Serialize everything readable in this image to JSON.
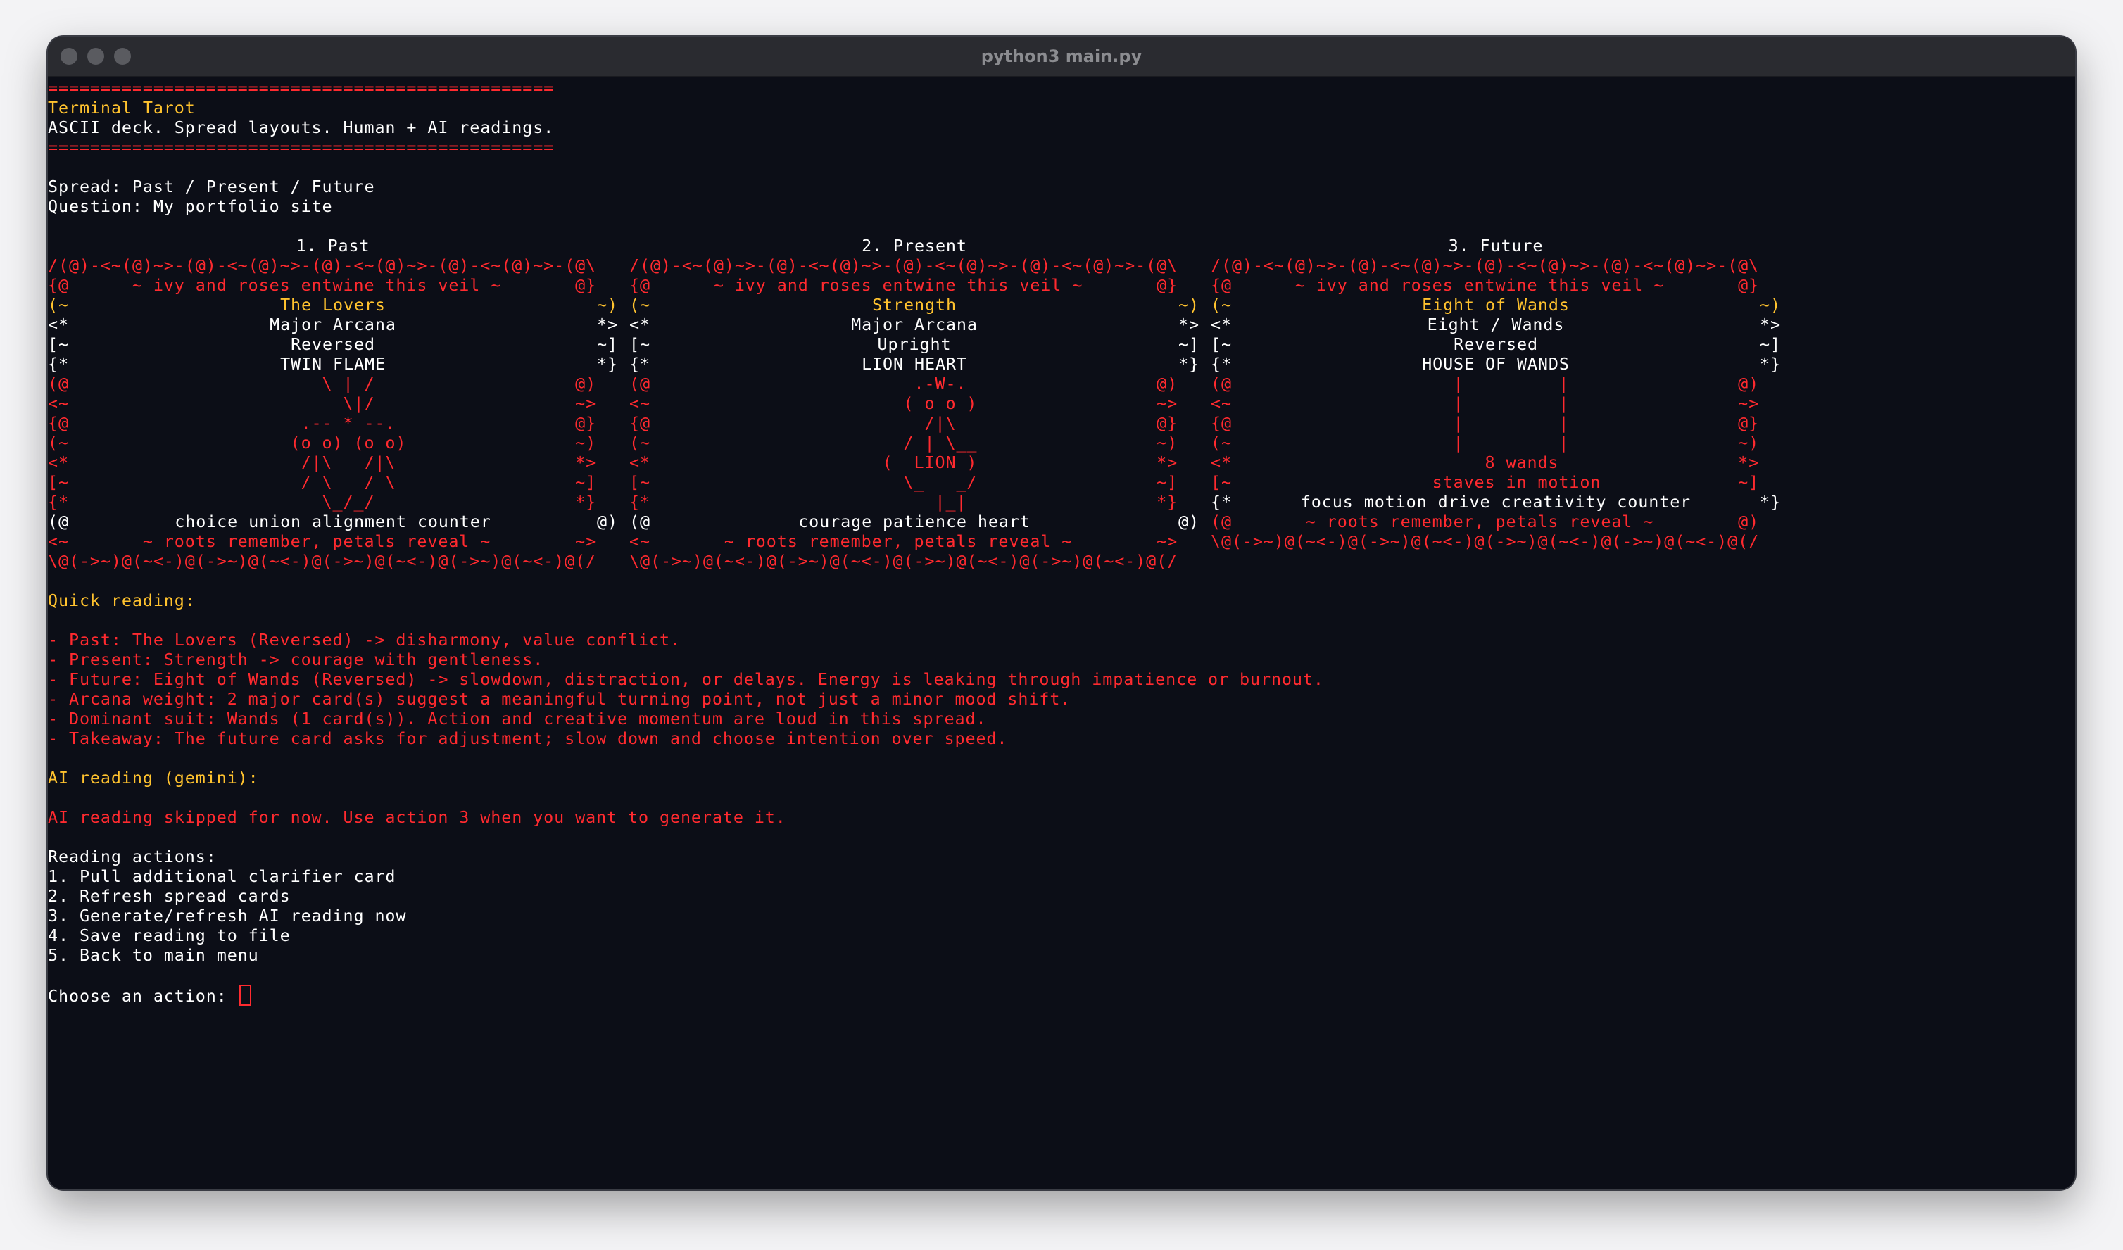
{
  "window": {
    "title": "python3 main.py"
  },
  "header": {
    "rule": "================================================",
    "app_name": "Terminal Tarot",
    "tagline": "ASCII deck. Spread layouts. Human + AI readings."
  },
  "spread": {
    "spread_line": "Spread: Past / Present / Future",
    "question_line": "Question: My portfolio site"
  },
  "cards": [
    {
      "heading": "1. Past",
      "top_border": "/(@)-<~(@)~>-(@)-<~(@)~>-(@)-<~(@)~>-(@)-<~(@)~>-(@\\",
      "motto_top": "{@      ~ ivy and roses entwine this veil ~       @}",
      "name_l": "(~",
      "name": "The Lovers",
      "name_r": "~)",
      "arcana_l": "<*",
      "arcana": "Major Arcana",
      "arcana_r": "*>",
      "orient_l": "[~",
      "orient": "Reversed",
      "orient_r": "~]",
      "title_l": "{*",
      "title": "TWIN FLAME",
      "title_r": "*}",
      "art": [
        "(@                        \\ | /                   @)",
        "<~                          \\|/                   ~>",
        "{@                      .-- * --.                 @}",
        "(~                     (o o) (o o)                ~)",
        "<*                      /|\\   /|\\                 *>",
        "[~                      / \\   / \\                 ~]",
        "{*                        \\_/_/                   *}"
      ],
      "kw_l": "(@",
      "keywords": "choice union alignment counter",
      "kw_r": "@)",
      "motto_bottom": "<~       ~ roots remember, petals reveal ~        ~>",
      "bottom_border": "\\@(->~)@(~<-)@(->~)@(~<-)@(->~)@(~<-)@(->~)@(~<-)@(/"
    },
    {
      "heading": "2. Present",
      "top_border": "/(@)-<~(@)~>-(@)-<~(@)~>-(@)-<~(@)~>-(@)-<~(@)~>-(@\\",
      "motto_top": "{@      ~ ivy and roses entwine this veil ~       @}",
      "name_l": "(~",
      "name": "Strength",
      "name_r": "~)",
      "arcana_l": "<*",
      "arcana": "Major Arcana",
      "arcana_r": "*>",
      "orient_l": "[~",
      "orient": "Upright",
      "orient_r": "~]",
      "title_l": "{*",
      "title": "LION HEART",
      "title_r": "*}",
      "art": [
        "(@                         .-W-.                  @)",
        "<~                        ( o o )                 ~>",
        "{@                          /|\\                   @}",
        "(~                        / | \\__                 ~)",
        "<*                      (  LION )                 *>",
        "[~                        \\_   _/                 ~]",
        "{*                           |_|                  *}"
      ],
      "kw_l": "(@",
      "keywords": "courage patience heart",
      "kw_r": "@)",
      "motto_bottom": "<~       ~ roots remember, petals reveal ~        ~>",
      "bottom_border": "\\@(->~)@(~<-)@(->~)@(~<-)@(->~)@(~<-)@(->~)@(~<-)@(/"
    },
    {
      "heading": "3. Future",
      "top_border": "/(@)-<~(@)~>-(@)-<~(@)~>-(@)-<~(@)~>-(@)-<~(@)~>-(@\\",
      "motto_top": "{@      ~ ivy and roses entwine this veil ~       @}",
      "name_l": "(~",
      "name": "Eight of Wands",
      "name_r": "~)",
      "arcana_l": "<*",
      "arcana": "Eight / Wands",
      "arcana_r": "*>",
      "orient_l": "[~",
      "orient": "Reversed",
      "orient_r": "~]",
      "title_l": "{*",
      "title": "HOUSE OF WANDS",
      "title_r": "*}",
      "art": [
        "(@                     |         |                @)",
        "<~                     |         |                ~>",
        "{@                     |         |                @}",
        "(~                     |         |                ~)",
        "<*                        8 wands                 *>",
        "[~                   staves in motion             ~]"
      ],
      "kw_l": "{*",
      "keywords": "focus motion drive creativity counter",
      "kw_r": "*}",
      "motto_bottom": "(@       ~ roots remember, petals reveal ~        @)",
      "bottom_border": "\\@(->~)@(~<-)@(->~)@(~<-)@(->~)@(~<-)@(->~)@(~<-)@(/"
    }
  ],
  "quick_reading": {
    "heading": "Quick reading:",
    "lines": [
      "- Past: The Lovers (Reversed) -> disharmony, value conflict.",
      "- Present: Strength -> courage with gentleness.",
      "- Future: Eight of Wands (Reversed) -> slowdown, distraction, or delays. Energy is leaking through impatience or burnout.",
      "- Arcana weight: 2 major card(s) suggest a meaningful turning point, not just a minor mood shift.",
      "- Dominant suit: Wands (1 card(s)). Action and creative momentum are loud in this spread.",
      "- Takeaway: The future card asks for adjustment; slow down and choose intention over speed."
    ]
  },
  "ai_reading": {
    "heading": "AI reading (gemini):",
    "message": "AI reading skipped for now. Use action 3 when you want to generate it."
  },
  "actions": {
    "heading": "Reading actions:",
    "items": [
      "1. Pull additional clarifier card",
      "2. Refresh spread cards",
      "3. Generate/refresh AI reading now",
      "4. Save reading to file",
      "5. Back to main menu"
    ],
    "prompt": "Choose an action: "
  },
  "colors": {
    "accent_red": "#ff2a2f",
    "accent_yellow": "#ffc22e",
    "text": "#ffffff",
    "background": "#0c0e17"
  }
}
